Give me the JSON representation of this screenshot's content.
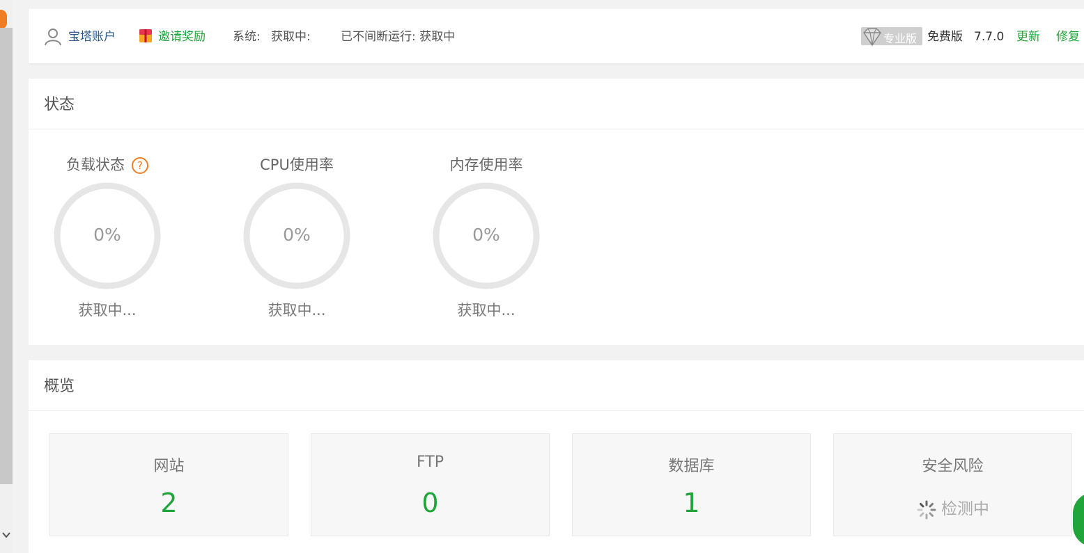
{
  "header": {
    "account_label": "宝塔账户",
    "invite_label": "邀请奖励",
    "system_label": "系统:",
    "system_value": "获取中:",
    "uptime_text": "已不间断运行: 获取中",
    "pro_badge": "专业版",
    "edition": "免费版",
    "version": "7.7.0",
    "update_link": "更新",
    "repair_link": "修复"
  },
  "status": {
    "title": "状态",
    "gauges": [
      {
        "label": "负载状态",
        "value": "0%",
        "text": "获取中...",
        "percent": 0
      },
      {
        "label": "CPU使用率",
        "value": "0%",
        "text": "获取中...",
        "percent": 0
      },
      {
        "label": "内存使用率",
        "value": "0%",
        "text": "获取中...",
        "percent": 0
      }
    ]
  },
  "overview": {
    "title": "概览",
    "cards": [
      {
        "label": "网站",
        "value": "2"
      },
      {
        "label": "FTP",
        "value": "0"
      },
      {
        "label": "数据库",
        "value": "1"
      },
      {
        "label": "安全风险",
        "status": "检测中"
      }
    ]
  },
  "colors": {
    "accent_green": "#20a53a",
    "warning_orange": "#f07d23",
    "ring_gray": "#e6e6e6"
  },
  "icons": [
    "user-icon",
    "gift-icon",
    "diamond-icon",
    "help-icon",
    "spinner-icon",
    "chevron-down-icon"
  ]
}
